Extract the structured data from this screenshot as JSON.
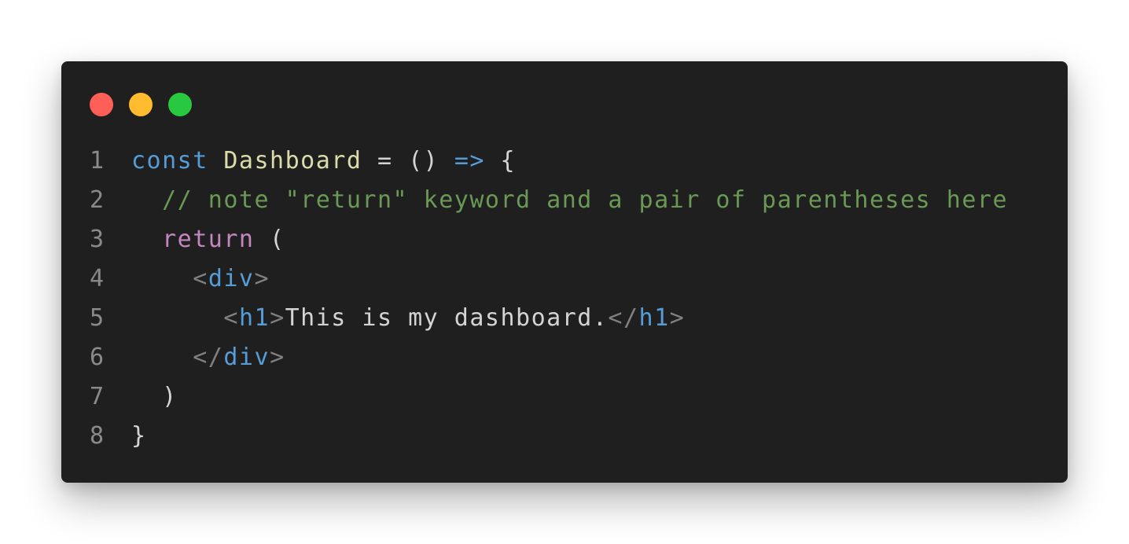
{
  "window": {
    "controls": [
      {
        "name": "close-button",
        "color": "#ff5f57"
      },
      {
        "name": "minimize-button",
        "color": "#febc2e"
      },
      {
        "name": "maximize-button",
        "color": "#28c840"
      }
    ]
  },
  "colors": {
    "background": "#1f1f1f",
    "keyword": "#569cd6",
    "function_name": "#dcdcaa",
    "plain": "#d4d4d4",
    "comment": "#6a9955",
    "control": "#c586c0",
    "tag_bracket": "#808080",
    "tag_name": "#569cd6",
    "line_number": "#8a8a8a"
  },
  "code": {
    "lines": [
      {
        "number": "1",
        "tokens": [
          {
            "text": "const",
            "type": "keyword"
          },
          {
            "text": " ",
            "type": "plain"
          },
          {
            "text": "Dashboard",
            "type": "function_name"
          },
          {
            "text": " = () ",
            "type": "plain"
          },
          {
            "text": "=>",
            "type": "keyword"
          },
          {
            "text": " {",
            "type": "plain"
          }
        ]
      },
      {
        "number": "2",
        "tokens": [
          {
            "text": "  ",
            "type": "plain"
          },
          {
            "text": "// note \"return\" keyword and a pair of parentheses here",
            "type": "comment"
          }
        ]
      },
      {
        "number": "3",
        "tokens": [
          {
            "text": "  ",
            "type": "plain"
          },
          {
            "text": "return",
            "type": "control"
          },
          {
            "text": " (",
            "type": "plain"
          }
        ]
      },
      {
        "number": "4",
        "tokens": [
          {
            "text": "    ",
            "type": "plain"
          },
          {
            "text": "<",
            "type": "tag_bracket"
          },
          {
            "text": "div",
            "type": "tag_name"
          },
          {
            "text": ">",
            "type": "tag_bracket"
          }
        ]
      },
      {
        "number": "5",
        "tokens": [
          {
            "text": "      ",
            "type": "plain"
          },
          {
            "text": "<",
            "type": "tag_bracket"
          },
          {
            "text": "h1",
            "type": "tag_name"
          },
          {
            "text": ">",
            "type": "tag_bracket"
          },
          {
            "text": "This is my dashboard.",
            "type": "plain"
          },
          {
            "text": "</",
            "type": "tag_bracket"
          },
          {
            "text": "h1",
            "type": "tag_name"
          },
          {
            "text": ">",
            "type": "tag_bracket"
          }
        ]
      },
      {
        "number": "6",
        "tokens": [
          {
            "text": "    ",
            "type": "plain"
          },
          {
            "text": "</",
            "type": "tag_bracket"
          },
          {
            "text": "div",
            "type": "tag_name"
          },
          {
            "text": ">",
            "type": "tag_bracket"
          }
        ]
      },
      {
        "number": "7",
        "tokens": [
          {
            "text": "  )",
            "type": "plain"
          }
        ]
      },
      {
        "number": "8",
        "tokens": [
          {
            "text": "}",
            "type": "plain"
          }
        ]
      }
    ]
  }
}
